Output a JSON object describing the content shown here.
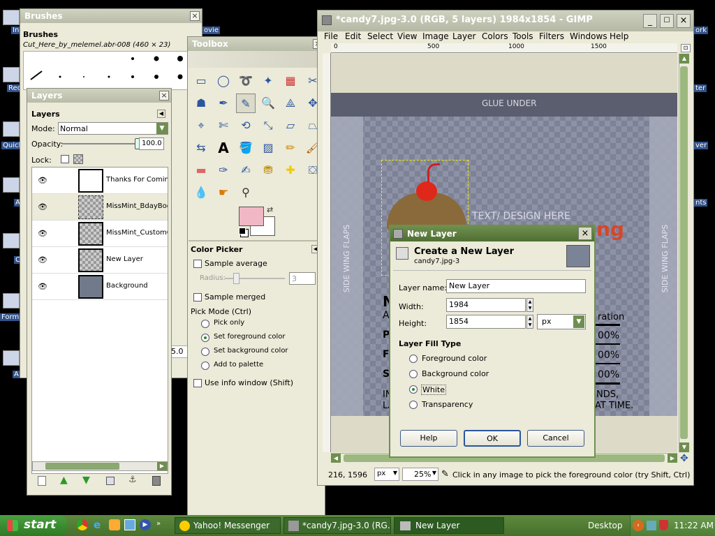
{
  "desktop": {
    "labels": [
      "In",
      "Rec",
      "Quick",
      "A",
      "C",
      "Form",
      "A Mar",
      "ovie",
      "ork",
      "ter",
      "ver",
      "nts"
    ]
  },
  "brushes": {
    "title": "Brushes",
    "heading": "Brushes",
    "brush_name": "Cut_Here_by_melemel.abr-008 (460 × 23)"
  },
  "layers": {
    "title": "Layers",
    "heading": "Layers",
    "mode_label": "Mode:",
    "mode_value": "Normal",
    "opacity_label": "Opacity:",
    "opacity_value": "100.0",
    "opacity_fraction": 1.0,
    "lock_label": "Lock:",
    "items": [
      {
        "name": "Thanks For Coming"
      },
      {
        "name": "MissMint_BdayBoogi"
      },
      {
        "name": "MissMint_CustomCar"
      },
      {
        "name": "New Layer"
      },
      {
        "name": "Background"
      }
    ],
    "side_value": "5.0"
  },
  "toolbox": {
    "title": "Toolbox",
    "fg_color": "#f0b8c4",
    "bg_color": "#ffffff"
  },
  "colorpicker": {
    "heading": "Color Picker",
    "sample_average": "Sample average",
    "radius_label": "Radius:",
    "radius_value": "3",
    "sample_merged": "Sample merged",
    "pick_mode": "Pick Mode  (Ctrl)",
    "options": [
      "Pick only",
      "Set foreground color",
      "Set background color",
      "Add to palette"
    ],
    "selected": 1,
    "info_window": "Use info window  (Shift)"
  },
  "gimp": {
    "title": "*candy7.jpg-3.0 (RGB, 5 layers) 1984x1854 - GIMP",
    "menu": [
      "File",
      "Edit",
      "Select",
      "View",
      "Image",
      "Layer",
      "Colors",
      "Tools",
      "Filters",
      "Windows",
      "Help"
    ],
    "ruler": [
      "0",
      "500",
      "1000",
      "1500"
    ],
    "canvas_texts": {
      "glue": "GLUE UNDER",
      "left_flap": "SIDE WING FLAPS",
      "right_flap": "SIDE WING FLAPS",
      "design": "TEXT/ DESIGN HERE",
      "ration": "ration",
      "pct1": "00%",
      "pct2": "00%",
      "pct3": "00%",
      "line1": "NDS,",
      "line2": "AT TIME.",
      "ng": "ng",
      "letters": [
        "N",
        "A",
        "P",
        "F",
        "S",
        "IN",
        "LA"
      ]
    },
    "coords": "216, 1596",
    "unit": "px",
    "zoom": "25%",
    "status": "Click in any image to pick the foreground color (try Shift, Ctrl)"
  },
  "dialog": {
    "title": "New Layer",
    "heading": "Create a New Layer",
    "subheading": "candy7.jpg-3",
    "name_label": "Layer name:",
    "name_value": "New Layer",
    "width_label": "Width:",
    "width_value": "1984",
    "height_label": "Height:",
    "height_value": "1854",
    "unit": "px",
    "fill_heading": "Layer Fill Type",
    "fill_options": [
      "Foreground color",
      "Background color",
      "White",
      "Transparency"
    ],
    "fill_selected": 2,
    "help": "Help",
    "ok": "OK",
    "cancel": "Cancel"
  },
  "taskbar": {
    "start": "start",
    "items": [
      "Yahoo! Messenger",
      "*candy7.jpg-3.0 (RG...",
      "New Layer"
    ],
    "desktop": "Desktop",
    "clock": "11:22 AM"
  }
}
